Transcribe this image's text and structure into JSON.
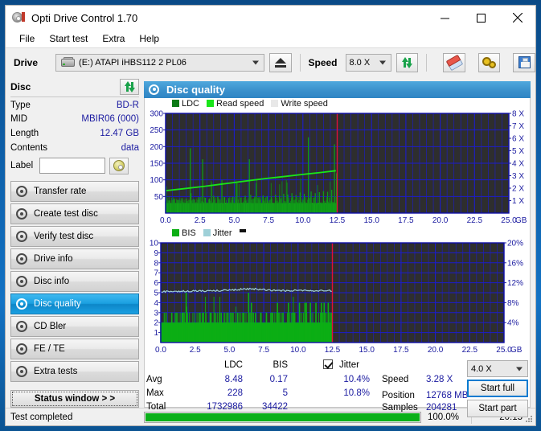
{
  "window": {
    "title": "Opti Drive Control 1.70",
    "minimize": "—",
    "maximize": "□",
    "close": "✕"
  },
  "menu": [
    "File",
    "Start test",
    "Extra",
    "Help"
  ],
  "toolbar": {
    "drive_label": "Drive",
    "drive_value": "(E:)   ATAPI iHBS112  2 PL06",
    "eject_tooltip": "Eject",
    "speed_label": "Speed",
    "speed_value": "8.0 X",
    "refresh_tooltip": "Refresh",
    "erase_tooltip": "Erase",
    "settings_tooltip": "Settings",
    "save_tooltip": "Save"
  },
  "disc": {
    "group_title": "Disc",
    "rows": [
      {
        "key": "Type",
        "value": "BD-R"
      },
      {
        "key": "MID",
        "value": "MBIR06 (000)"
      },
      {
        "key": "Length",
        "value": "12.47 GB"
      },
      {
        "key": "Contents",
        "value": "data"
      }
    ],
    "label_key": "Label",
    "label_value": "",
    "label_placeholder": ""
  },
  "nav": {
    "items": [
      {
        "label": "Transfer rate",
        "active": false
      },
      {
        "label": "Create test disc",
        "active": false
      },
      {
        "label": "Verify test disc",
        "active": false
      },
      {
        "label": "Drive info",
        "active": false
      },
      {
        "label": "Disc info",
        "active": false
      },
      {
        "label": "Disc quality",
        "active": true
      },
      {
        "label": "CD Bler",
        "active": false
      },
      {
        "label": "FE / TE",
        "active": false
      },
      {
        "label": "Extra tests",
        "active": false
      }
    ],
    "status_window": "Status window > >"
  },
  "panel": {
    "title": "Disc quality"
  },
  "stats": {
    "col_headers": [
      "LDC",
      "BIS"
    ],
    "jitter_label": "Jitter",
    "jitter_checked": true,
    "rows": [
      {
        "label": "Avg",
        "ldc": "8.48",
        "bis": "0.17",
        "jitter": "10.4%"
      },
      {
        "label": "Max",
        "ldc": "228",
        "bis": "5",
        "jitter": "10.8%"
      },
      {
        "label": "Total",
        "ldc": "1732986",
        "bis": "34422",
        "jitter": ""
      }
    ],
    "speed_label": "Speed",
    "speed_value": "3.28 X",
    "position_label": "Position",
    "position_value": "12768 MB",
    "samples_label": "Samples",
    "samples_value": "204281",
    "speed_select_value": "4.0 X",
    "start_full": "Start full",
    "start_part": "Start part"
  },
  "statusbar": {
    "text": "Test completed",
    "percent_label": "100.0%",
    "percent": 100,
    "time": "20:15"
  },
  "colors": {
    "ldc": "#0c7a16",
    "read_speed": "#19e619",
    "write_speed": "#e8e8e8",
    "bis": "#0cae14",
    "jitter": "#9fd0d8",
    "grid": "#1c1ccc",
    "plot_bg": "#2e2e2e",
    "axis_text": "#1a1aa0",
    "marker": "#e01038",
    "accent": "#0a7bd0"
  },
  "chart_data": [
    {
      "id": "ldc-chart",
      "type": "area",
      "title": "",
      "legend": [
        {
          "label": "LDC",
          "color": "#0c7a16"
        },
        {
          "label": "Read speed",
          "color": "#19e619"
        },
        {
          "label": "Write speed",
          "color": "#e8e8e8"
        }
      ],
      "legend_position": "top-left",
      "grid": true,
      "xlabel": "GB",
      "xlim": [
        0.0,
        25.0
      ],
      "xticks": [
        "0.0",
        "2.5",
        "5.0",
        "7.5",
        "10.0",
        "12.5",
        "15.0",
        "17.5",
        "20.0",
        "22.5",
        "25.0"
      ],
      "ylabel": "",
      "ylim": [
        0,
        300
      ],
      "yticks": [
        "50",
        "100",
        "150",
        "200",
        "250",
        "300"
      ],
      "y2label": "",
      "y2lim": [
        0,
        8
      ],
      "y2ticks": [
        "1 X",
        "2 X",
        "3 X",
        "4 X",
        "5 X",
        "6 X",
        "7 X",
        "8 X"
      ],
      "data_end_gb": 12.5,
      "marker_gb": 12.5,
      "series": [
        {
          "name": "LDC",
          "color": "#0c7a16",
          "note": "dense error spikes, baseline ~10-40, peaks up to 228",
          "x": [
            0.0,
            0.3,
            0.6,
            0.9,
            1.2,
            1.5,
            1.8,
            1.85,
            2.1,
            2.4,
            2.7,
            2.9,
            3.2,
            3.5,
            3.8,
            4.1,
            4.3,
            4.6,
            4.9,
            5.2,
            5.5,
            5.8,
            6.1,
            6.2,
            6.5,
            6.8,
            7.1,
            7.4,
            7.7,
            8.0,
            8.3,
            8.6,
            8.9,
            9.2,
            9.5,
            9.8,
            10.1,
            10.4,
            10.6,
            10.9,
            11.2,
            11.5,
            11.8,
            12.1,
            12.3,
            12.45
          ],
          "values": [
            35,
            38,
            42,
            40,
            45,
            44,
            195,
            60,
            41,
            48,
            162,
            46,
            44,
            52,
            50,
            100,
            48,
            45,
            49,
            90,
            47,
            52,
            162,
            55,
            50,
            48,
            53,
            51,
            49,
            55,
            52,
            58,
            56,
            60,
            54,
            62,
            58,
            228,
            65,
            60,
            63,
            66,
            64,
            70,
            207,
            120
          ]
        },
        {
          "name": "Read speed",
          "color": "#19e619",
          "note": "smooth CAV ramp from ~1.8X to ~3.4X",
          "x": [
            0.0,
            1.25,
            2.5,
            3.75,
            5.0,
            6.25,
            7.5,
            8.75,
            10.0,
            11.25,
            12.4
          ],
          "values": [
            1.8,
            1.95,
            2.1,
            2.28,
            2.45,
            2.63,
            2.8,
            2.95,
            3.1,
            3.25,
            3.4
          ]
        },
        {
          "name": "Write speed",
          "color": "#e8e8e8",
          "x": [],
          "values": []
        }
      ]
    },
    {
      "id": "bis-chart",
      "type": "area",
      "title": "",
      "legend": [
        {
          "label": "BIS",
          "color": "#0cae14"
        },
        {
          "label": "Jitter",
          "color": "#9fd0d8"
        }
      ],
      "legend_position": "top-left",
      "grid": true,
      "xlabel": "GB",
      "xlim": [
        0.0,
        25.0
      ],
      "xticks": [
        "0.0",
        "2.5",
        "5.0",
        "7.5",
        "10.0",
        "12.5",
        "15.0",
        "17.5",
        "20.0",
        "22.5",
        "25.0"
      ],
      "ylabel": "",
      "ylim": [
        0,
        10
      ],
      "yticks": [
        "1",
        "2",
        "3",
        "4",
        "5",
        "6",
        "7",
        "8",
        "9",
        "10"
      ],
      "y2label": "",
      "y2lim": [
        0,
        20
      ],
      "y2ticks": [
        "4%",
        "8%",
        "12%",
        "16%",
        "20%"
      ],
      "data_end_gb": 12.5,
      "marker_gb": 12.5,
      "series": [
        {
          "name": "BIS",
          "color": "#0cae14",
          "note": "baseline ~2, frequent spikes to 3, occasional 4-5",
          "x": [
            0.0,
            0.4,
            0.8,
            1.2,
            1.6,
            1.85,
            2.0,
            2.4,
            2.8,
            3.2,
            3.6,
            4.0,
            4.4,
            4.8,
            5.2,
            5.6,
            6.0,
            6.4,
            6.6,
            6.9,
            7.3,
            7.7,
            8.1,
            8.5,
            8.9,
            9.3,
            9.7,
            10.1,
            10.5,
            10.6,
            10.9,
            11.3,
            11.7,
            11.9,
            12.2,
            12.45
          ],
          "values": [
            2,
            2,
            3,
            2,
            3,
            5,
            2,
            2,
            3,
            2,
            3,
            2,
            3,
            2,
            3,
            3,
            3,
            5,
            4,
            3,
            3,
            3,
            3,
            4,
            3,
            4,
            3,
            4,
            4,
            4,
            4,
            4,
            4,
            4,
            4,
            3
          ]
        },
        {
          "name": "Jitter",
          "color": "#9fd0d8",
          "note": "flat trace near 10.2-10.8% (plotted ~5.1-5.4 on 0-10 left scale)",
          "x": [
            0.0,
            1.0,
            2.0,
            3.0,
            4.0,
            5.0,
            6.0,
            6.5,
            7.0,
            7.5,
            8.0,
            9.0,
            10.0,
            11.0,
            12.0,
            12.45
          ],
          "values": [
            5.1,
            5.12,
            5.15,
            5.18,
            5.2,
            5.25,
            5.35,
            5.4,
            5.35,
            5.3,
            5.25,
            5.2,
            5.22,
            5.2,
            5.2,
            5.2
          ]
        }
      ]
    }
  ]
}
